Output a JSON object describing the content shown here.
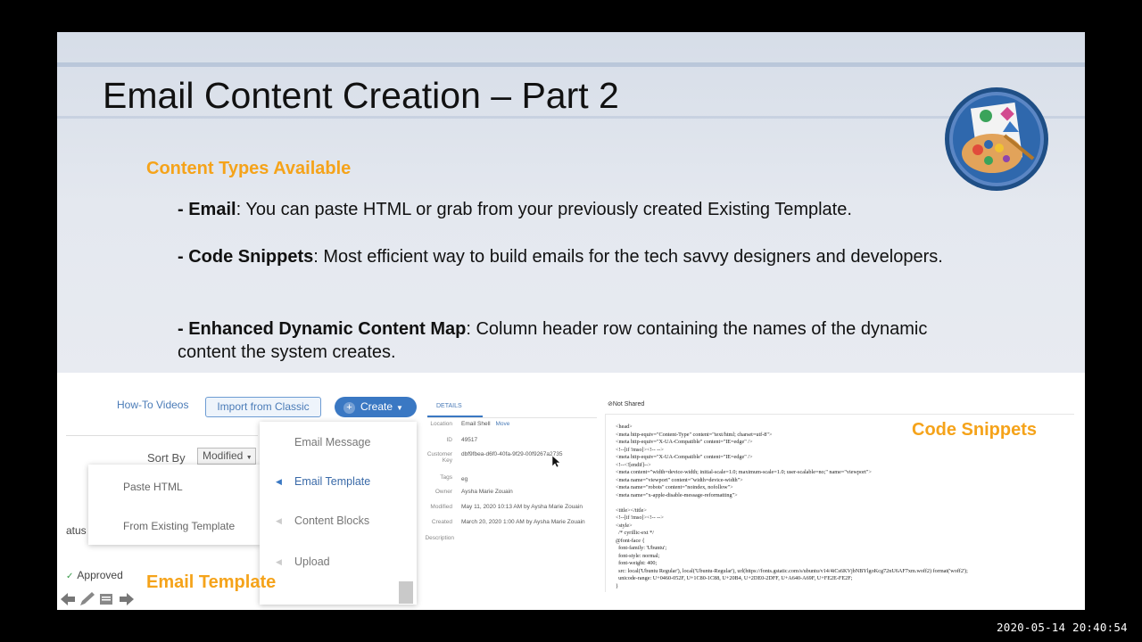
{
  "slide": {
    "title": "Email Content Creation – Part 2",
    "subheading": "Content Types Available",
    "bullets": [
      {
        "term": "Email",
        "prefix": "- ",
        "text": ": You can paste HTML or grab from your previously created Existing Template."
      },
      {
        "term": "Code Snippets",
        "prefix": "- ",
        "text": ": Most efficient way to build emails for the tech savvy designers and developers."
      },
      {
        "term": "Enhanced Dynamic Content Map",
        "prefix": "- ",
        "text": ": Column header row containing the names of the dynamic content the system creates."
      }
    ],
    "logo_icon": "palette-icon"
  },
  "email_screenshot": {
    "howto_link": "How-To Videos",
    "import_button": "Import from Classic",
    "create_button": "Create",
    "sort_by_label": "Sort By",
    "sort_value": "Modified",
    "status_text": "atus",
    "approved_text": "Approved",
    "paste_menu": [
      "Paste HTML",
      "From Existing Template"
    ],
    "create_menu": [
      "Email Message",
      "Email Template",
      "Content Blocks",
      "Upload"
    ],
    "label": "Email Template"
  },
  "details": {
    "tab": "DETAILS",
    "rows": [
      {
        "key": "Location",
        "value": "Email Shell",
        "extra": "Move"
      },
      {
        "key": "ID",
        "value": "49517"
      },
      {
        "key": "Customer Key",
        "value": "dbf9fbea-d6f0-40fa-9f29-00f9267a2735"
      },
      {
        "key": "Tags",
        "value": "eg"
      },
      {
        "key": "Owner",
        "value": "Aysha Marie Zouain"
      },
      {
        "key": "Modified",
        "value": "May 11, 2020 10:13 AM by Aysha Marie Zouain"
      },
      {
        "key": "Created",
        "value": "March 20, 2020 1:00 AM by Aysha Marie Zouain"
      },
      {
        "key": "Description",
        "value": ""
      }
    ]
  },
  "code_screenshot": {
    "header": "Not Shared",
    "label": "Code Snippets",
    "code": "<head>\n<meta http-equiv=\"Content-Type\" content=\"text/html; charset=utf-8\">\n<meta http-equiv=\"X-UA-Compatible\" content=\"IE=edge\" />\n<!--[if !mso]><!-- -->\n<meta http-equiv=\"X-UA-Compatible\" content=\"IE=edge\" />\n<!--<![endif]-->\n<meta content=\"width=device-width; initial-scale=1.0; maximum-scale=1.0; user-scalable=no;\" name=\"viewport\">\n<meta name=\"viewport\" content=\"width=device-width\">\n<meta name=\"robots\" content=\"noindex, nofollow\">\n<meta name=\"x-apple-disable-message-reformatting\">\n\n<title></title>\n<!--[if !mso]><!-- -->\n<style>\n  /* cyrillic-ext */\n@font-face {\n  font-family: 'Ubuntu';\n  font-style: normal;\n  font-weight: 400;\n  src: local('Ubuntu Regular'), local('Ubuntu-Regular'), url(https://fonts.gstatic.com/s/ubuntu/v14/4iCs6KVjbNBYlgoKcg72nU6AF7xm.woff2) format('woff2');\n  unicode-range: U+0460-052F, U+1C80-1C88, U+20B4, U+2DE0-2DFF, U+A640-A69F, U+FE2E-FE2F;\n}"
  },
  "timestamp": "2020-05-14  20:40:54"
}
